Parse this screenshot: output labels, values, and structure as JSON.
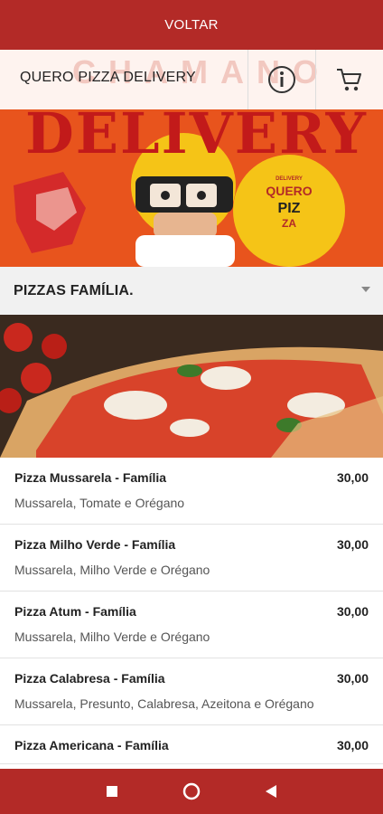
{
  "topbar": {
    "back_label": "VOLTAR"
  },
  "header": {
    "brand": "QUERO PIZZA DELIVERY",
    "bg_word": "CHAMANO"
  },
  "banner": {
    "headline": "DELIVERY"
  },
  "category": {
    "label": "PIZZAS FAMÍLIA."
  },
  "items": [
    {
      "name": "Pizza Mussarela - Família",
      "price": "30,00",
      "desc": "Mussarela, Tomate e Orégano"
    },
    {
      "name": "Pizza Milho Verde - Família",
      "price": "30,00",
      "desc": "Mussarela, Milho Verde e Orégano"
    },
    {
      "name": "Pizza Atum - Família",
      "price": "30,00",
      "desc": "Mussarela, Milho Verde e Orégano"
    },
    {
      "name": "Pizza Calabresa - Família",
      "price": "30,00",
      "desc": "Mussarela, Presunto, Calabresa, Azeitona e Orégano"
    },
    {
      "name": "Pizza Americana - Família",
      "price": "30,00",
      "desc": ""
    }
  ],
  "logo_text": {
    "small": "DELIVERY",
    "big": "QUERO",
    "piz": "PIZ",
    "za": "ZA"
  },
  "colors": {
    "brand_red": "#b32a27",
    "banner_orange": "#e8541d"
  },
  "icons": {
    "info": "info-icon",
    "cart": "cart-icon",
    "nav_square": "recent-apps-icon",
    "nav_circle": "home-icon",
    "nav_back": "back-icon"
  }
}
